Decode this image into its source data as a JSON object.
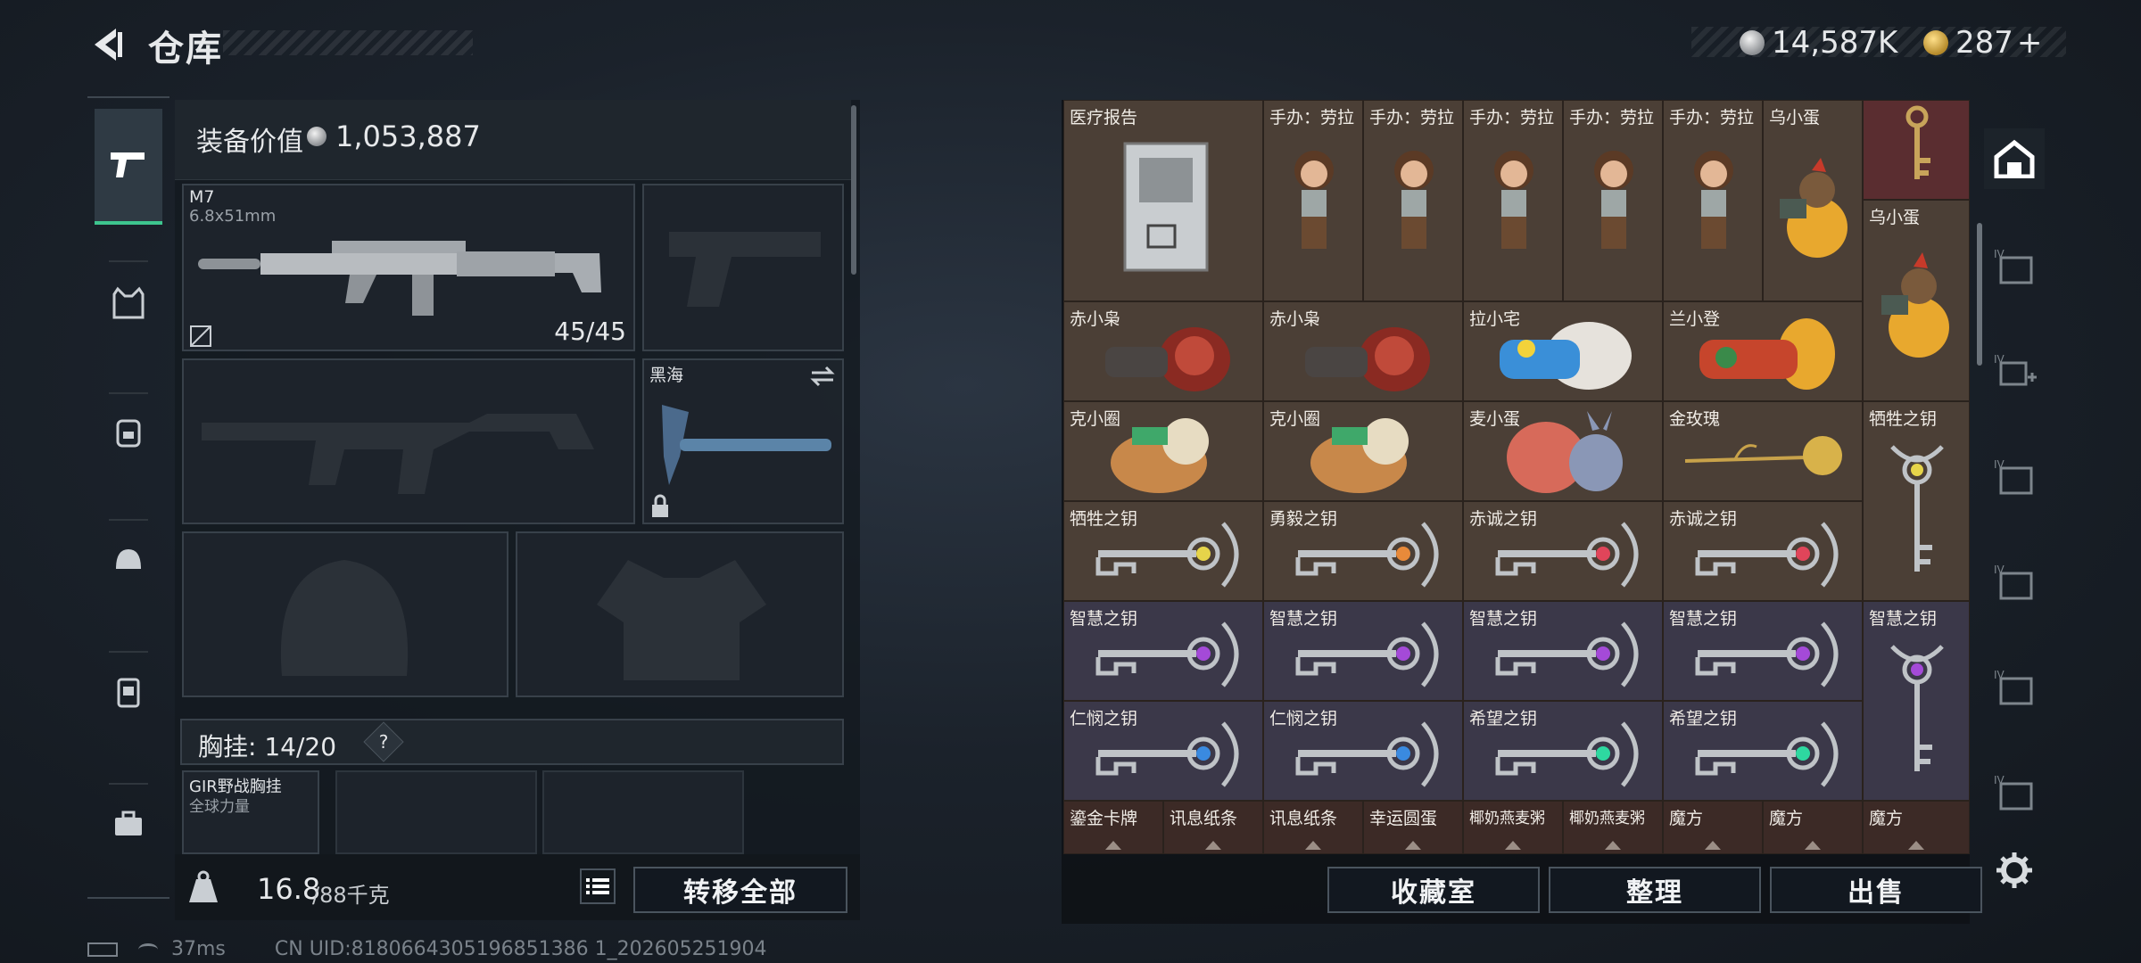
{
  "header": {
    "title": "仓库"
  },
  "currency": {
    "silver": "14,587K",
    "gold": "287",
    "plus": "+"
  },
  "nav": [
    "firearms-icon",
    "armor-vest-icon",
    "backpack-icon",
    "helmet-backpack-icon",
    "chest-rig-icon",
    "toolbox-icon"
  ],
  "equip": {
    "value_label": "装备价值",
    "value": "1,053,887",
    "primary": {
      "name": "M7",
      "ammo": "6.8x51mm",
      "count": "45/45"
    },
    "melee": {
      "name": "黑海"
    },
    "chest": {
      "label": "胸挂:",
      "current": "14",
      "sep": "/",
      "max": "20",
      "help": "?"
    },
    "rig": {
      "name": "GIR野战胸挂",
      "sub": "全球力量"
    },
    "weight": {
      "current": "16.8",
      "rest": "/88千克"
    },
    "transfer_all": "转移全部"
  },
  "grid": {
    "rows": [
      [
        "医疗报告",
        "手办：劳拉",
        "手办：劳拉",
        "手办：劳拉",
        "手办：劳拉",
        "手办：劳拉",
        "乌小蛋",
        ""
      ],
      [
        "赤小枭",
        "赤小枭",
        "拉小宅",
        "兰小登",
        "乌小蛋"
      ],
      [
        "克小圈",
        "克小圈",
        "麦小蛋",
        "金玫瑰",
        "牺牲之钥"
      ],
      [
        "牺牲之钥",
        "勇毅之钥",
        "赤诚之钥",
        "赤诚之钥"
      ],
      [
        "智慧之钥",
        "智慧之钥",
        "智慧之钥",
        "智慧之钥",
        "智慧之钥"
      ],
      [
        "仁悯之钥",
        "仁悯之钥",
        "希望之钥",
        "希望之钥"
      ],
      [
        "鎏金卡牌",
        "讯息纸条",
        "讯息纸条",
        "幸运圆蛋",
        "椰奶燕麦粥",
        "椰奶燕麦粥",
        "魔方",
        "魔方",
        "魔方"
      ]
    ]
  },
  "actions": {
    "collection": "收藏室",
    "organize": "整理",
    "sell": "出售"
  },
  "status": {
    "ping": "37ms",
    "uid": "CN UID:8180664305196851386 1_202605251904"
  }
}
